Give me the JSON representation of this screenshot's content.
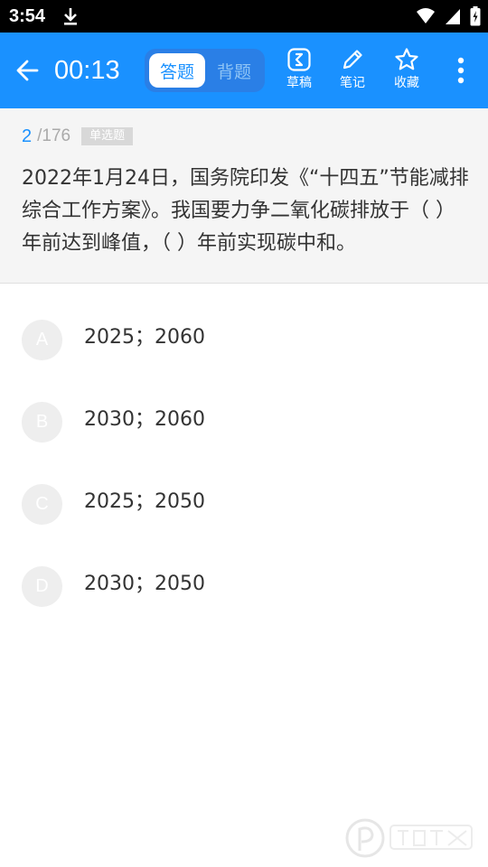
{
  "status_bar": {
    "time": "3:54",
    "icons": [
      "download-icon",
      "wifi-icon",
      "signal-icon",
      "battery-icon"
    ]
  },
  "toolbar": {
    "timer": "00:13",
    "tabs": [
      {
        "label": "答题",
        "active": true
      },
      {
        "label": "背题",
        "active": false
      }
    ],
    "actions": [
      {
        "label": "草稿",
        "icon": "draft-icon"
      },
      {
        "label": "笔记",
        "icon": "pencil-icon"
      },
      {
        "label": "收藏",
        "icon": "star-icon"
      }
    ]
  },
  "question": {
    "current": "2",
    "total": "/176",
    "type": "单选题",
    "text": "2022年1月24日，国务院印发《“十四五”节能减排综合工作方案》。我国要力争二氧化碳排放于（ ）年前达到峰值，（ ）年前实现碳中和。"
  },
  "options": [
    {
      "letter": "A",
      "text": "2025；2060"
    },
    {
      "letter": "B",
      "text": "2030；2060"
    },
    {
      "letter": "C",
      "text": "2025；2050"
    },
    {
      "letter": "D",
      "text": "2030；2050"
    }
  ],
  "colors": {
    "primary": "#1a91ff",
    "toggle_bg": "#2a7fe6",
    "question_bg": "#f5f5f5",
    "option_circle": "#eeeeee"
  }
}
